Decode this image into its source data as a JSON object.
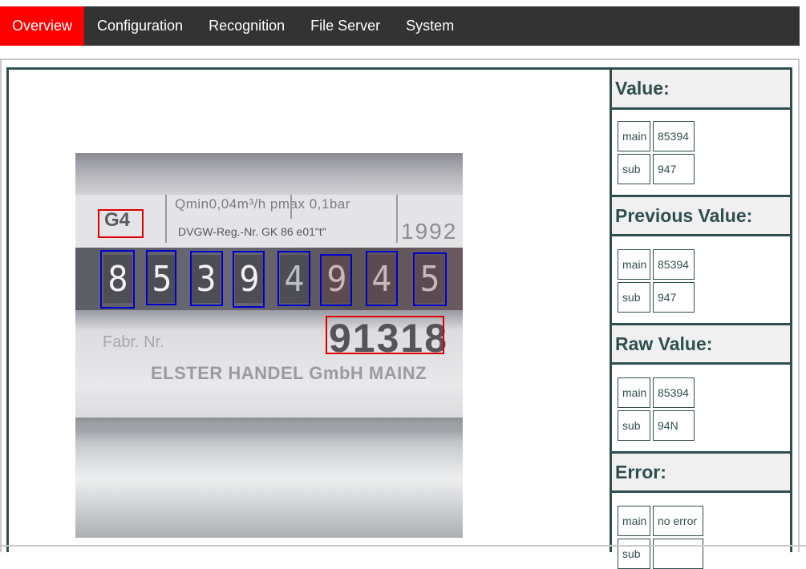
{
  "nav": {
    "items": [
      "Overview",
      "Configuration",
      "Recognition",
      "File Server",
      "System"
    ],
    "active": "Overview",
    "active_color": "#ff0000",
    "bar_color": "#333333"
  },
  "image": {
    "meter_text_top": "Qmin0,04m³/h  pmax 0,1bar",
    "reg_text": "DVGW-Reg.-Nr.   GK 86 e01\"t\"",
    "year_text": "1992",
    "type_label": "G4",
    "digits": [
      "8",
      "5",
      "3",
      "9",
      "4",
      "9",
      "4",
      "5"
    ],
    "fabr_label": "Fabr. Nr.",
    "serial": "91318",
    "maker": "ELSTER HANDEL GmbH MAINZ"
  },
  "panel": {
    "value": {
      "title": "Value:",
      "rows": [
        [
          "main",
          "85394"
        ],
        [
          "sub",
          "947"
        ]
      ]
    },
    "previous": {
      "title": "Previous Value:",
      "rows": [
        [
          "main",
          "85394"
        ],
        [
          "sub",
          "947"
        ]
      ]
    },
    "raw": {
      "title": "Raw Value:",
      "rows": [
        [
          "main",
          "85394"
        ],
        [
          "sub",
          "94N"
        ]
      ]
    },
    "error": {
      "title": "Error:",
      "rows": [
        [
          "main",
          "no error"
        ],
        [
          "sub",
          ""
        ]
      ]
    }
  },
  "colors": {
    "accent": "#2f4f4f",
    "roi_digit": "#0000cc",
    "roi_analog": "#dd0000"
  }
}
